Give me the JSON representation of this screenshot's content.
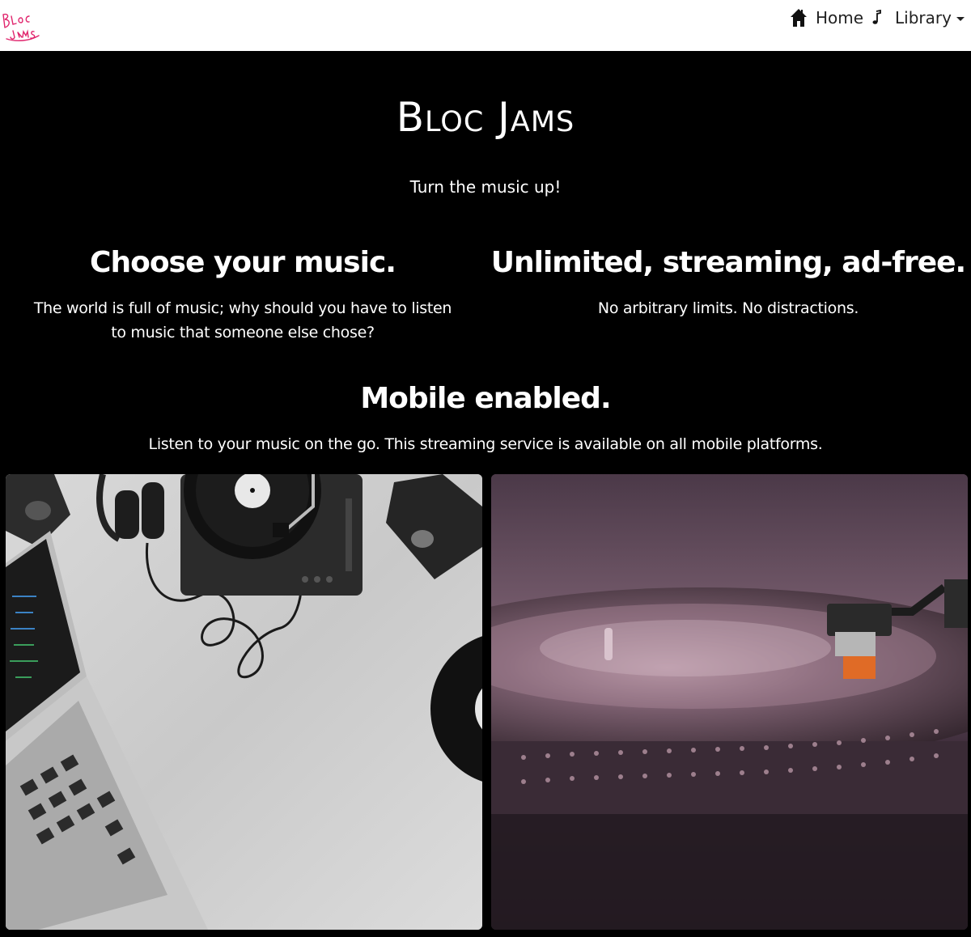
{
  "navbar": {
    "logo": {
      "text": "Bloc Jams",
      "icon": "bloc-jams-logo",
      "color": "#e0246c"
    },
    "items": [
      {
        "label": "Home",
        "icon": "home-icon"
      },
      {
        "label": "Library",
        "icon": "music-note-icon",
        "dropdown": true
      }
    ]
  },
  "hero": {
    "title": "Bloc Jams",
    "tagline": "Turn the music up!"
  },
  "selling_points": [
    {
      "title": "Choose your music.",
      "text": "The world is full of music; why should you have to listen to music that someone else chose?"
    },
    {
      "title": "Unlimited, streaming, ad-free.",
      "text": "No arbitrary limits. No distractions."
    },
    {
      "title": "Mobile enabled.",
      "text": "Listen to your music on the go. This streaming service is available on all mobile platforms."
    }
  ],
  "images": [
    {
      "name": "laptop-headphones-turntable-photo"
    },
    {
      "name": "vinyl-record-player-photo"
    }
  ],
  "colors": {
    "background": "#000000",
    "navbar": "#ffffff",
    "text": "#ffffff",
    "accent": "#e0246c"
  }
}
